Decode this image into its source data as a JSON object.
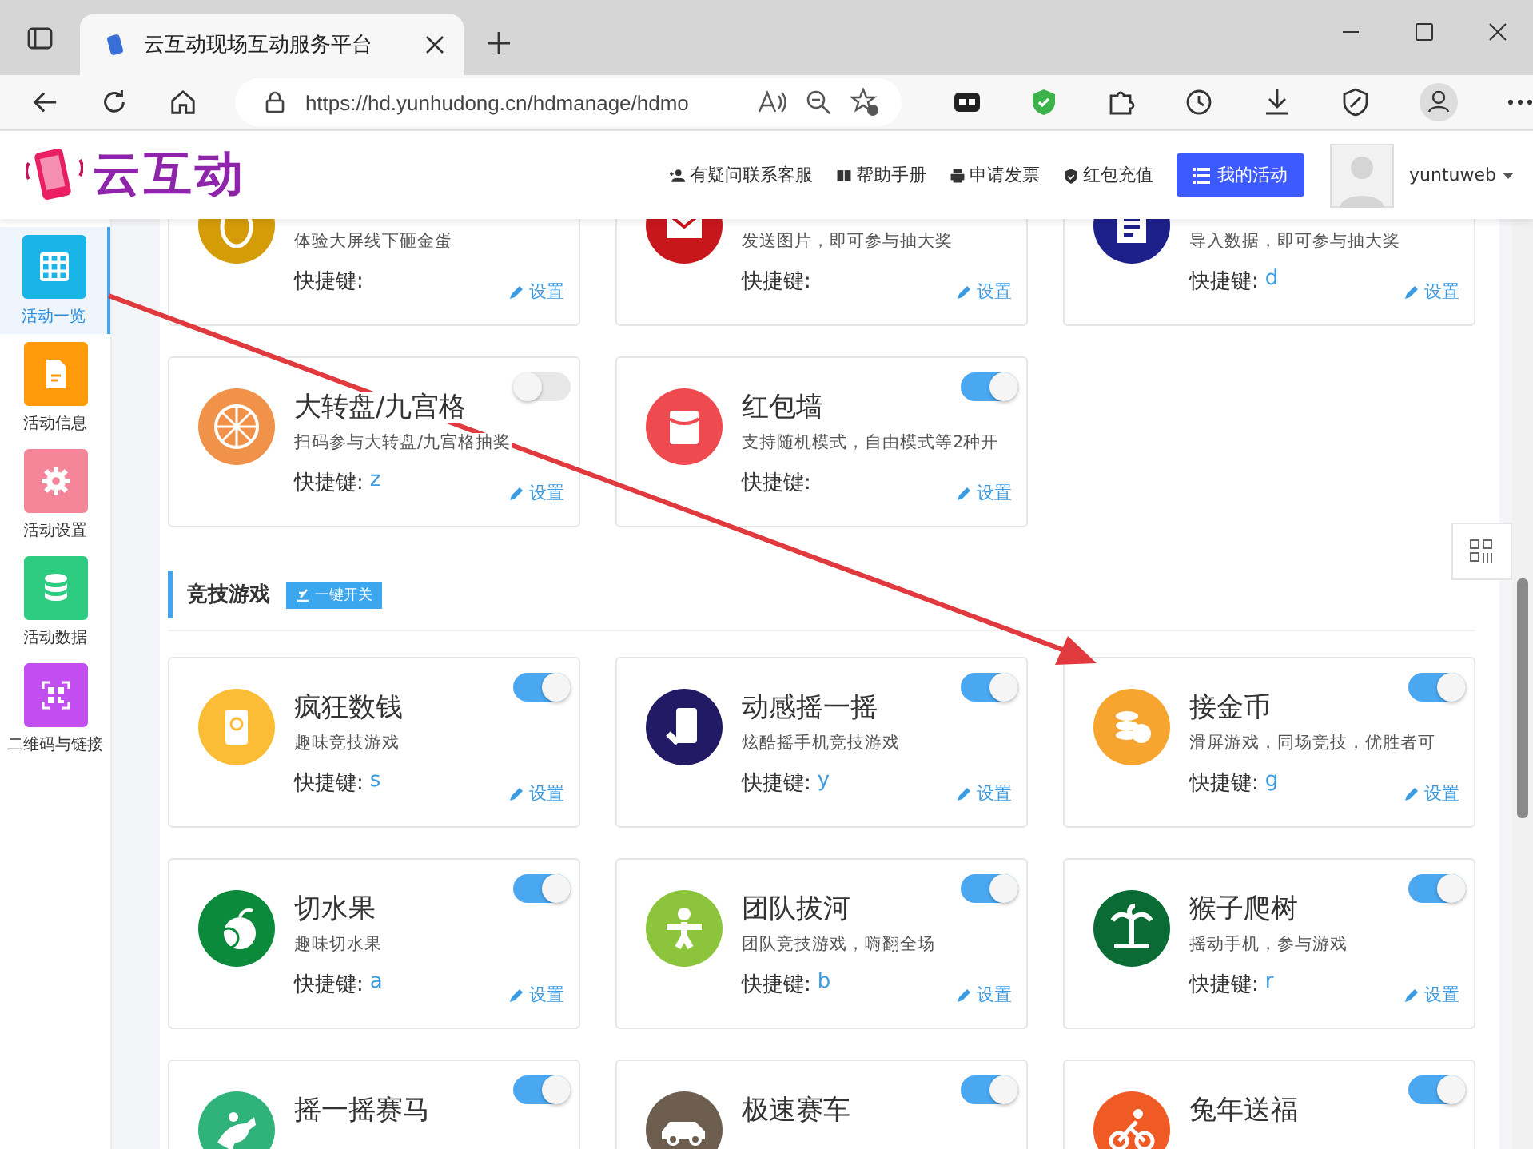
{
  "browser": {
    "tab_title": "云互动现场互动服务平台",
    "url": "https://hd.yunhudong.cn/hdmanage/hdmo"
  },
  "header": {
    "logo": "云互动",
    "links": [
      "有疑问联系客服",
      "帮助手册",
      "申请发票",
      "红包充值"
    ],
    "primary_button": "我的活动",
    "username": "yuntuweb"
  },
  "sidebar": {
    "items": [
      {
        "label": "活动一览",
        "selected": true,
        "color": "#1ab5e8"
      },
      {
        "label": "活动信息",
        "selected": false,
        "color": "#ff9a0a"
      },
      {
        "label": "活动设置",
        "selected": false,
        "color": "#f5869a"
      },
      {
        "label": "活动数据",
        "selected": false,
        "color": "#2ecc80"
      },
      {
        "label": "二维码与链接",
        "selected": false,
        "color": "#c24ef0"
      }
    ]
  },
  "top_cards": [
    {
      "kind": "egg",
      "description": "体验大屏线下砸金蛋",
      "shortcut_label": "快捷键:",
      "settings": "设置",
      "color": "#d49c06"
    },
    {
      "kind": "envelope",
      "description": "发送图片，即可参与抽大奖",
      "shortcut_label": "快捷键:",
      "settings": "设置",
      "color": "#c8161d"
    },
    {
      "kind": "document",
      "description": "导入数据，即可参与抽大奖",
      "shortcut_label": "快捷键:",
      "shortcut": "d",
      "settings": "设置",
      "color": "#1d2088"
    },
    {
      "kind": "wheel",
      "title": "大转盘/九宫格",
      "description": "扫码参与大转盘/九宫格抽奖",
      "shortcut_label": "快捷键:",
      "shortcut": "z",
      "on": false,
      "settings": "设置",
      "color": "#f0924a"
    },
    {
      "kind": "packet",
      "title": "红包墙",
      "description": "支持随机模式，自由模式等2种开",
      "shortcut_label": "快捷键:",
      "on": true,
      "settings": "设置",
      "color": "#ef4a4f"
    }
  ],
  "section": {
    "title": "竞技游戏",
    "toggle_all": "一键开关",
    "cards": [
      {
        "kind": "cards",
        "title": "疯狂数钱",
        "description": "趣味竞技游戏",
        "shortcut_label": "快捷键:",
        "shortcut": "s",
        "on": true,
        "settings": "设置",
        "color": "#fbbd36"
      },
      {
        "kind": "phone",
        "title": "动感摇一摇",
        "description": "炫酷摇手机竞技游戏",
        "shortcut_label": "快捷键:",
        "shortcut": "y",
        "on": true,
        "settings": "设置",
        "color": "#231a66"
      },
      {
        "kind": "coins",
        "title": "接金币",
        "description": "滑屏游戏，同场竞技，优胜者可",
        "shortcut_label": "快捷键:",
        "shortcut": "g",
        "on": true,
        "settings": "设置",
        "color": "#f8a530"
      },
      {
        "kind": "fruit",
        "title": "切水果",
        "description": "趣味切水果",
        "shortcut_label": "快捷键:",
        "shortcut": "a",
        "on": true,
        "settings": "设置",
        "color": "#0c8a3c"
      },
      {
        "kind": "person",
        "title": "团队拔河",
        "description": "团队竞技游戏，嗨翻全场",
        "shortcut_label": "快捷键:",
        "shortcut": "b",
        "on": true,
        "settings": "设置",
        "color": "#8cc43c"
      },
      {
        "kind": "palm",
        "title": "猴子爬树",
        "description": "摇动手机，参与游戏",
        "shortcut_label": "快捷键:",
        "shortcut": "r",
        "on": true,
        "settings": "设置",
        "color": "#0a6b34"
      },
      {
        "kind": "horse",
        "title": "摇一摇赛马",
        "on": true,
        "color": "#2fb37a"
      },
      {
        "kind": "car",
        "title": "极速赛车",
        "on": true,
        "color": "#6d5e50"
      },
      {
        "kind": "bike",
        "title": "兔年送福",
        "on": true,
        "color": "#f05a24"
      }
    ]
  }
}
